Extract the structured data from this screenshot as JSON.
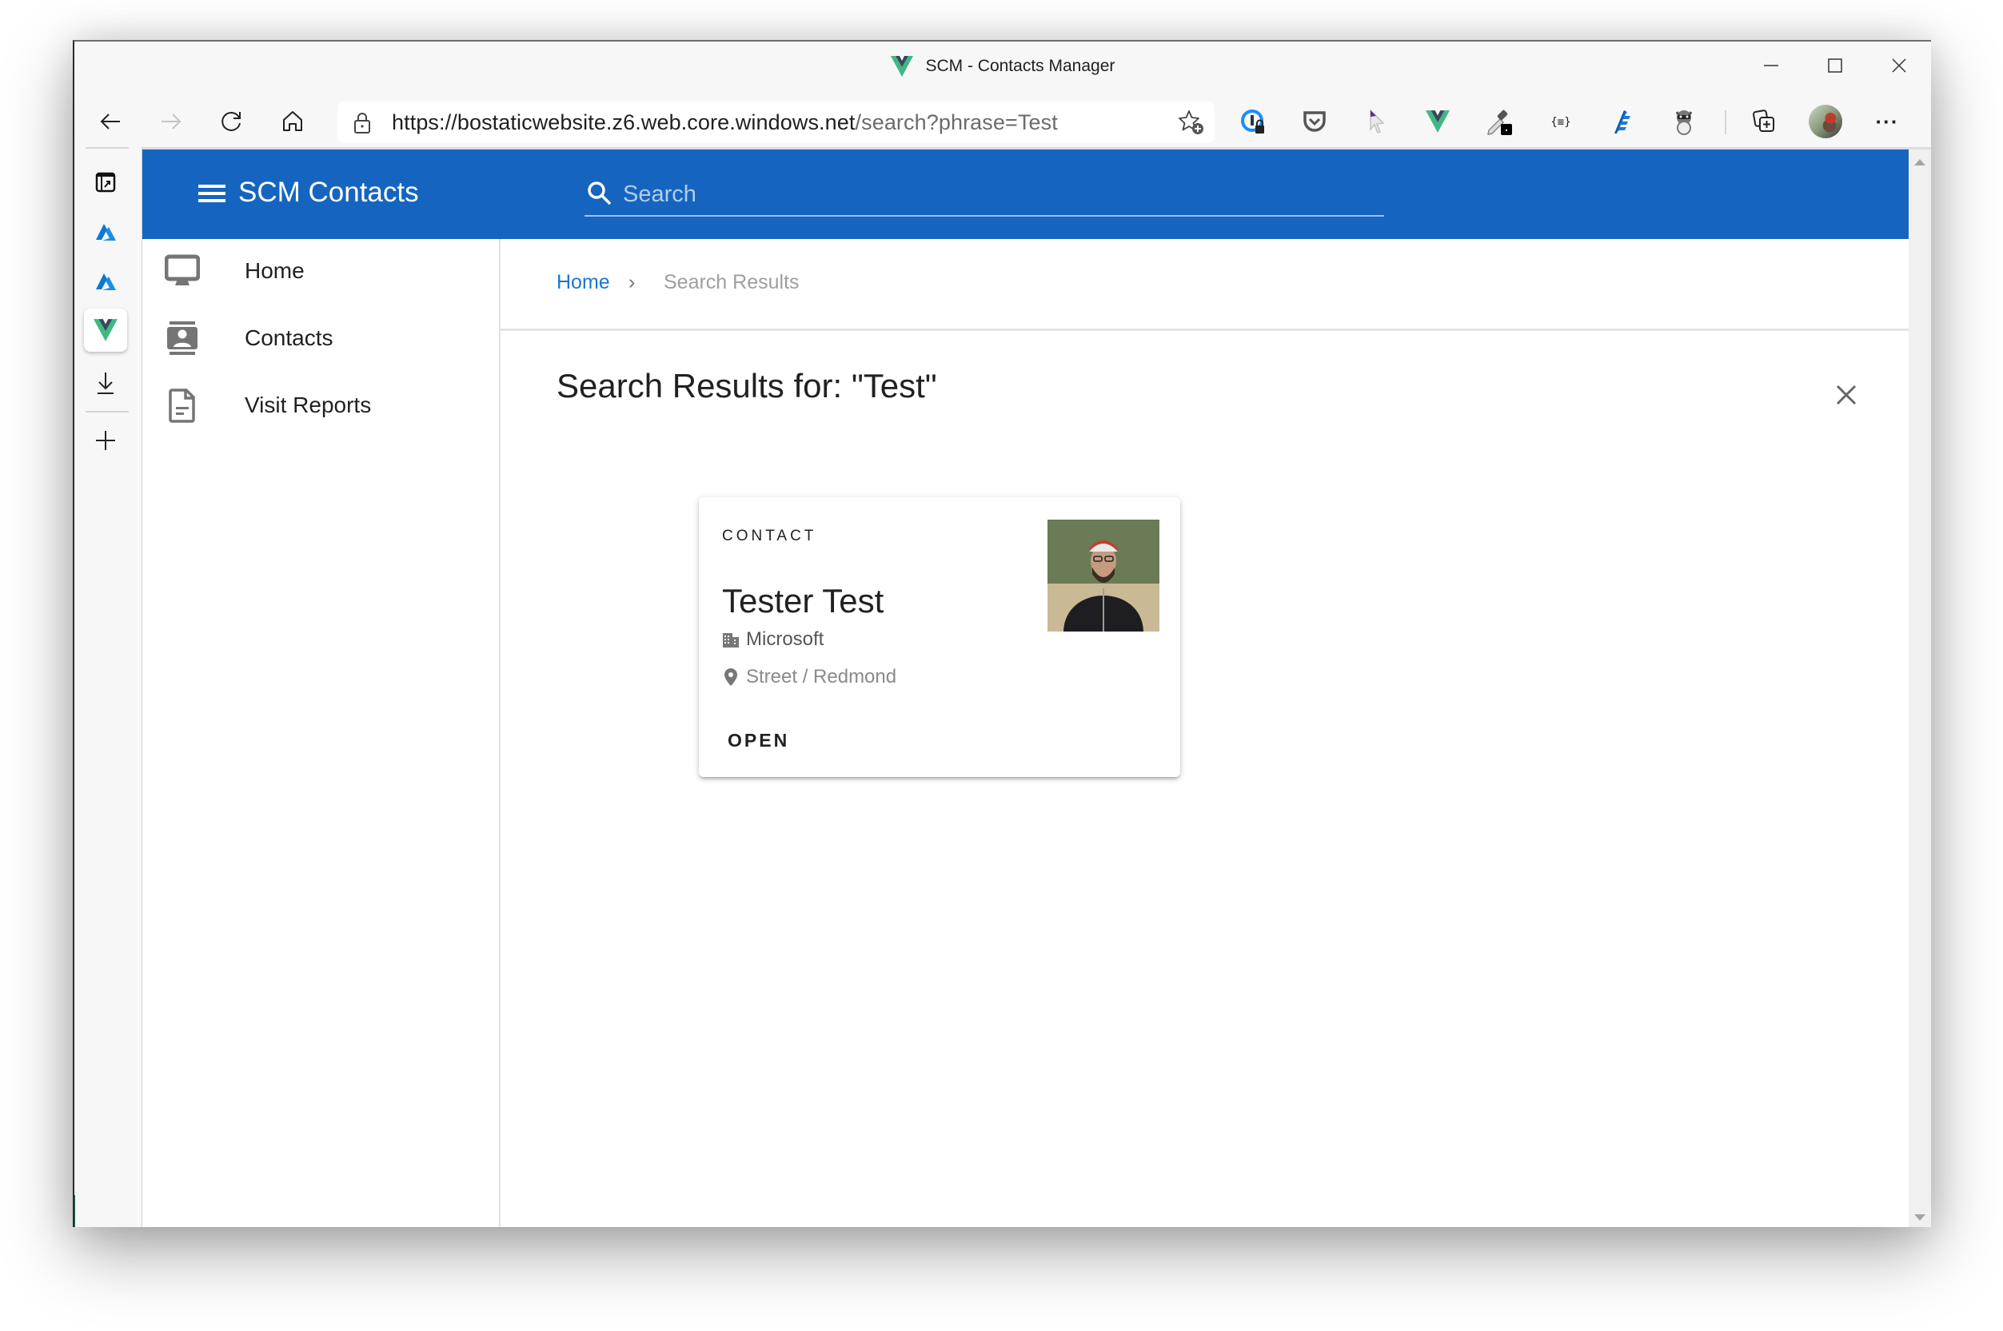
{
  "browser": {
    "window_title": "SCM - Contacts Manager",
    "url_host": "https://bostaticwebsite.z6.web.core.windows.net",
    "url_path": "/search?phrase=Test",
    "window_controls": [
      "minimize-icon",
      "maximize-icon",
      "close-icon"
    ],
    "nav_buttons": [
      "back-icon",
      "forward-icon",
      "refresh-icon",
      "home-icon"
    ],
    "extensions": [
      "favorites-add-icon",
      "password-manager-icon",
      "pocket-icon",
      "pointer-extension-icon",
      "vue-devtools-icon",
      "eyedropper-icon",
      "json-formatter-icon",
      "editor-extension-icon",
      "raccoon-extension-icon",
      "collections-icon",
      "profile-avatar",
      "more-menu-icon"
    ],
    "more_label": "···",
    "vertical_tabs": [
      {
        "icon": "tab-actions-icon",
        "active": false
      },
      {
        "icon": "azure-icon",
        "active": false
      },
      {
        "icon": "azure-icon",
        "active": false
      },
      {
        "icon": "vue-icon",
        "active": true
      },
      {
        "icon": "download-icon",
        "active": false
      }
    ],
    "new_tab_icon": "plus-icon"
  },
  "app": {
    "title": "SCM Contacts",
    "brand_color": "#1565c0",
    "search": {
      "placeholder": "Search",
      "value": ""
    },
    "nav": [
      {
        "label": "Home",
        "icon": "monitor-icon"
      },
      {
        "label": "Contacts",
        "icon": "contact-card-icon"
      },
      {
        "label": "Visit Reports",
        "icon": "document-icon"
      }
    ]
  },
  "main": {
    "breadcrumb": {
      "home": "Home",
      "separator": "›",
      "current": "Search Results"
    },
    "title": "Search Results for: \"Test\"",
    "results": [
      {
        "type": "CONTACT",
        "name": "Tester Test",
        "company": "Microsoft",
        "address": "Street / Redmond",
        "action": "OPEN",
        "photo": "contact-photo"
      }
    ]
  }
}
